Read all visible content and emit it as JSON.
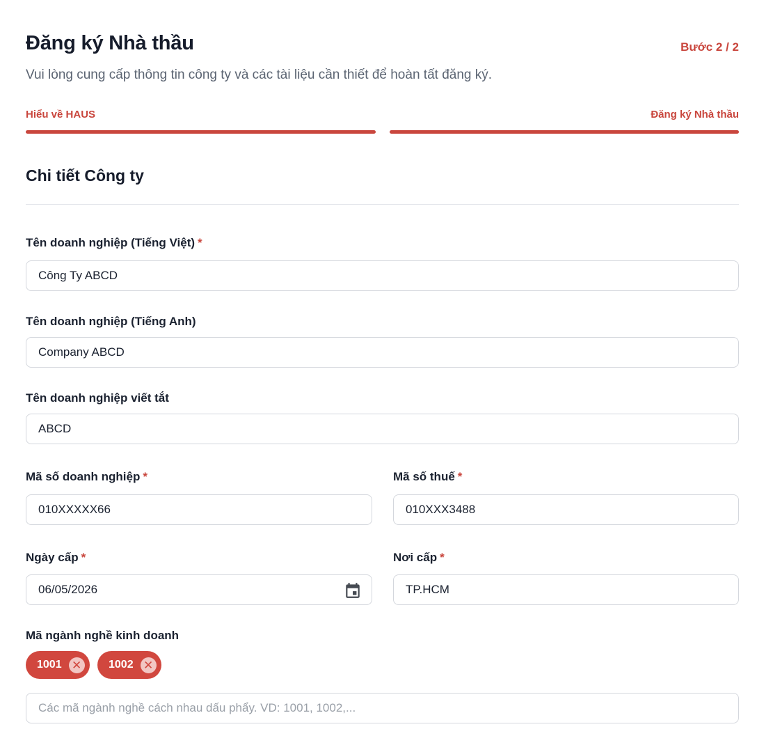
{
  "header": {
    "title": "Đăng ký Nhà thầu",
    "step": "Bước 2 / 2",
    "subtitle": "Vui lòng cung cấp thông tin công ty và các tài liệu cần thiết để hoàn tất đăng ký."
  },
  "progress": {
    "steps": [
      {
        "label": "Hiểu về HAUS",
        "complete": true
      },
      {
        "label": "Đăng ký Nhà thầu",
        "complete": true
      }
    ],
    "color": "#c9463d"
  },
  "section": {
    "title": "Chi tiết Công ty"
  },
  "fields": {
    "name_vi": {
      "label": "Tên doanh nghiệp (Tiếng Việt)",
      "required_mark": "*",
      "value": "Công Ty ABCD"
    },
    "name_en": {
      "label": "Tên doanh nghiệp (Tiếng Anh)",
      "value": "Company ABCD"
    },
    "name_short": {
      "label": "Tên doanh nghiệp viết tắt",
      "value": "ABCD"
    },
    "business_code": {
      "label": "Mã số doanh nghiệp",
      "required_mark": "*",
      "value": "010XXXXX66"
    },
    "tax_code": {
      "label": "Mã số thuế",
      "required_mark": "*",
      "value": "010XXX3488"
    },
    "issue_date": {
      "label": "Ngày cấp",
      "required_mark": "*",
      "value": "06/05/2026",
      "icon": "calendar-icon"
    },
    "issue_place": {
      "label": "Nơi cấp",
      "required_mark": "*",
      "value": "TP.HCM"
    },
    "industry_codes": {
      "label": "Mã ngành nghề kinh doanh",
      "chips": [
        "1001",
        "1002"
      ],
      "remove_icon": "close-circle-icon",
      "placeholder": "Các mã ngành nghề cách nhau dấu phẩy. VD: 1001, 1002,..."
    }
  },
  "colors": {
    "accent": "#c9463d",
    "chip_bg": "#d1473e",
    "border": "#d4d7dd"
  }
}
